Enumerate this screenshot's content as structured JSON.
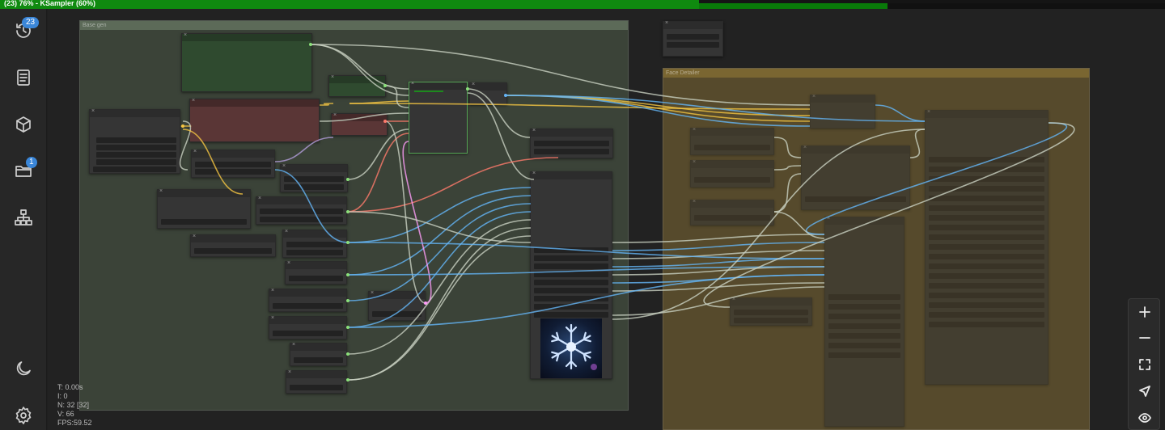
{
  "progress": {
    "label": "(23) 76% - KSampler (60%)",
    "overall_percent": 76,
    "step_percent": 60,
    "color": "#0f8a0f"
  },
  "sidebar": {
    "items": [
      {
        "name": "queue-history-icon",
        "badge": "23"
      },
      {
        "name": "node-library-icon",
        "badge": ""
      },
      {
        "name": "model-library-icon",
        "badge": ""
      },
      {
        "name": "workflows-icon",
        "badge": "1"
      },
      {
        "name": "node-map-icon",
        "badge": ""
      }
    ],
    "bottom": [
      {
        "name": "theme-toggle-icon"
      },
      {
        "name": "settings-icon"
      }
    ]
  },
  "groups": {
    "base": {
      "title": "Base gen",
      "color": "#3b4338"
    },
    "face": {
      "title": "Face Detailer",
      "color": "#564a2c"
    }
  },
  "stats": {
    "t": "T: 0.00s",
    "i": "I: 0",
    "n": "N: 32 [32]",
    "v": "V: 66",
    "fps": "FPS:59.52"
  },
  "zoom_controls": [
    {
      "name": "zoom-in-icon"
    },
    {
      "name": "zoom-out-icon"
    },
    {
      "name": "fit-view-icon"
    },
    {
      "name": "locate-icon"
    },
    {
      "name": "toggle-links-icon"
    }
  ],
  "colors": {
    "accent": "#3a86d8",
    "wire_model": "#b39ddb",
    "wire_clip": "#f5c542",
    "wire_vae": "#ff7a6b",
    "wire_latent": "#ff9cf9",
    "wire_image": "#64b5f6",
    "wire_default": "#c9d1c2"
  }
}
